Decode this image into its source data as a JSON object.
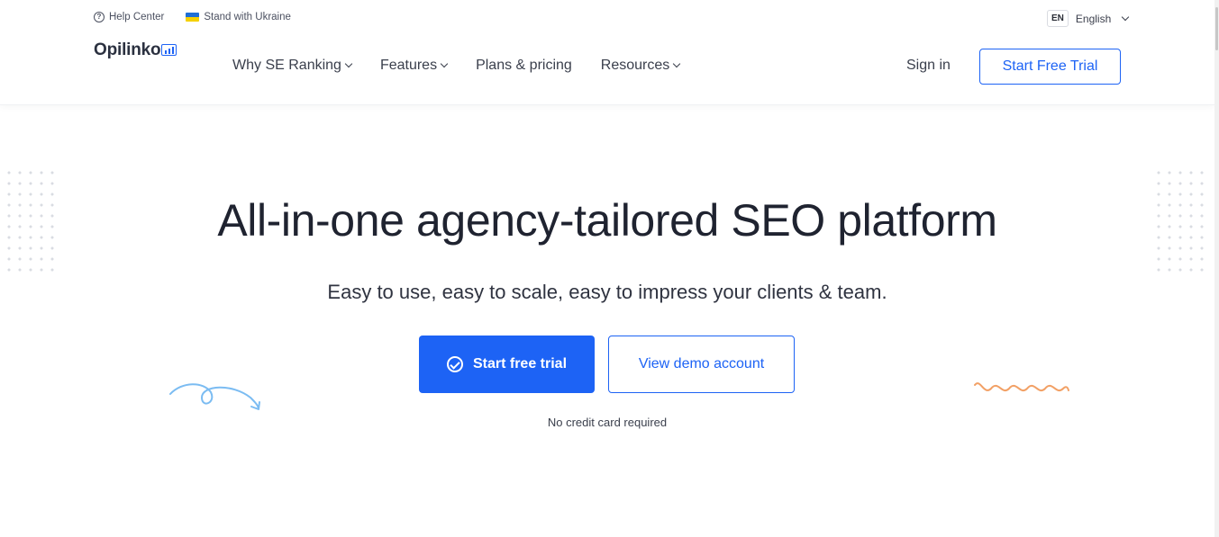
{
  "topbar": {
    "help_center": "Help Center",
    "ukraine": "Stand with Ukraine",
    "lang_code": "EN",
    "lang_name": "English"
  },
  "logo": {
    "text": "Opilinko"
  },
  "nav": {
    "items": [
      {
        "label": "Why SE Ranking",
        "has_dropdown": true
      },
      {
        "label": "Features",
        "has_dropdown": true
      },
      {
        "label": "Plans & pricing",
        "has_dropdown": false
      },
      {
        "label": "Resources",
        "has_dropdown": true
      }
    ],
    "sign_in": "Sign in",
    "start_trial": "Start Free Trial"
  },
  "hero": {
    "title": "All-in-one agency-tailored SEO platform",
    "subtitle": "Easy to use, easy to scale, easy to impress your clients & team.",
    "primary_cta": "Start free trial",
    "secondary_cta": "View demo account",
    "note": "No credit card required"
  },
  "colors": {
    "accent": "#1d63f5",
    "text": "#1f2330",
    "squiggle_left": "#7bbcf2",
    "squiggle_right": "#f2a065"
  },
  "icons": [
    "help-icon",
    "ukraine-flag-icon",
    "chevron-down-icon",
    "logo-chart-icon",
    "check-circle-icon"
  ]
}
